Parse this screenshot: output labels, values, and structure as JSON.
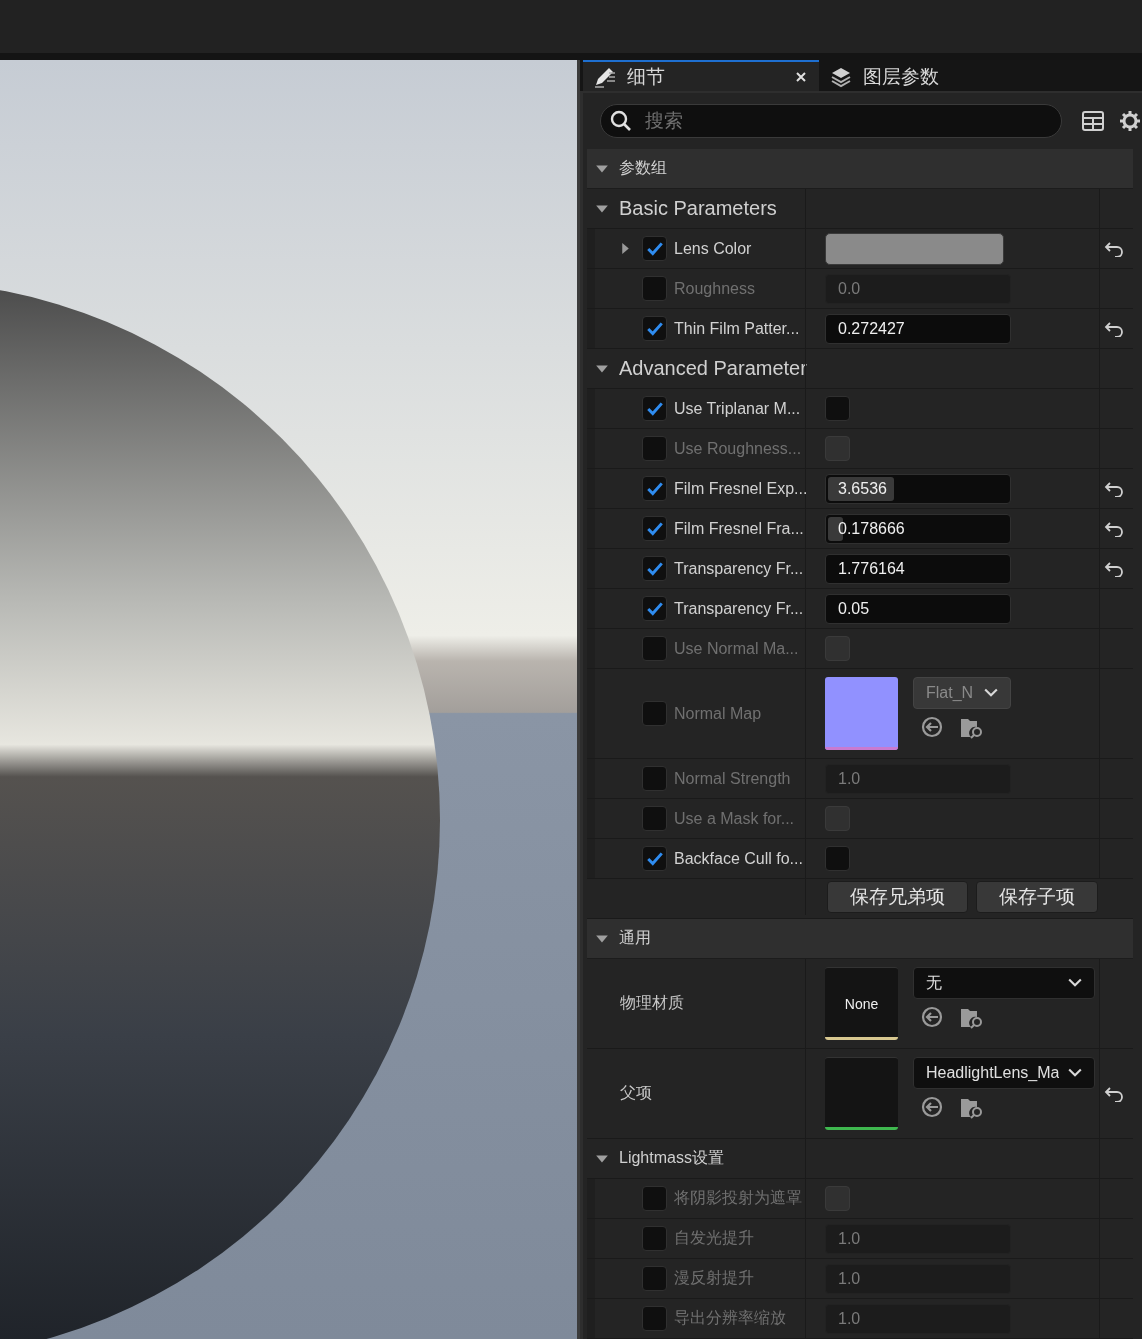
{
  "tabs": [
    {
      "label": "细节",
      "selected": true,
      "closable": true
    },
    {
      "label": "图层参数",
      "selected": false,
      "closable": false
    }
  ],
  "search": {
    "placeholder": "搜索"
  },
  "sections": [
    {
      "kind": "category",
      "title": "参数组",
      "expanded": true,
      "children": [
        {
          "kind": "group",
          "title": "Basic Parameters",
          "expanded": true,
          "rows": [
            {
              "kind": "color",
              "label": "Lens Color",
              "checked": true,
              "expanded": false,
              "color": "#8a8a8a",
              "reset": true
            },
            {
              "kind": "number",
              "label": "Roughness",
              "checked": false,
              "value": "0.0",
              "reset": false
            },
            {
              "kind": "number",
              "label": "Thin Film Patter...",
              "checked": true,
              "value": "0.272427",
              "reset": true
            }
          ]
        },
        {
          "kind": "group",
          "title": "Advanced Parameter",
          "expanded": true,
          "rows": [
            {
              "kind": "bool",
              "label": "Use Triplanar M...",
              "checked": true,
              "on": false,
              "reset": false
            },
            {
              "kind": "bool",
              "label": "Use Roughness...",
              "checked": false,
              "on": false,
              "reset": false
            },
            {
              "kind": "number",
              "label": "Film Fresnel Exp...",
              "checked": true,
              "value": "3.6536",
              "level": 0.36,
              "reset": true
            },
            {
              "kind": "number",
              "label": "Film Fresnel Fra...",
              "checked": true,
              "value": "0.178666",
              "level": 0.08,
              "reset": true
            },
            {
              "kind": "number",
              "label": "Transparency Fr...",
              "checked": true,
              "value": "1.776164",
              "reset": true
            },
            {
              "kind": "number",
              "label": "Transparency Fr...",
              "checked": true,
              "value": "0.05",
              "reset": false
            },
            {
              "kind": "bool",
              "label": "Use Normal Ma...",
              "checked": false,
              "on": false,
              "reset": false
            },
            {
              "kind": "texture",
              "label": "Normal Map",
              "checked": false,
              "value": "Flat_N",
              "color": "#c97ad0",
              "reset": false
            },
            {
              "kind": "number",
              "label": "Normal Strength",
              "checked": false,
              "value": "1.0",
              "reset": false
            },
            {
              "kind": "bool",
              "label": "Use a Mask for...",
              "checked": false,
              "on": false,
              "reset": false
            },
            {
              "kind": "bool",
              "label": "Backface Cull fo...",
              "checked": true,
              "on": false,
              "reset": false
            }
          ],
          "buttons": [
            "保存兄弟项",
            "保存子项"
          ]
        }
      ]
    },
    {
      "kind": "category",
      "title": "通用",
      "expanded": true,
      "rows": [
        {
          "kind": "asset",
          "label": "物理材质",
          "thumb": "None",
          "value": "无",
          "color": "#d8c890",
          "reset": false
        },
        {
          "kind": "asset",
          "label": "父项",
          "value": "HeadlightLens_Ma",
          "color": "#3fb84f",
          "reset": true
        }
      ]
    },
    {
      "kind": "subcategory",
      "title": "Lightmass设置",
      "expanded": true,
      "rows": [
        {
          "kind": "bool",
          "label": "将阴影投射为遮罩",
          "checked": false,
          "on": false,
          "reset": false
        },
        {
          "kind": "number",
          "label": "自发光提升",
          "checked": false,
          "value": "1.0",
          "reset": false
        },
        {
          "kind": "number",
          "label": "漫反射提升",
          "checked": false,
          "value": "1.0",
          "reset": false
        },
        {
          "kind": "number",
          "label": "导出分辨率缩放",
          "checked": false,
          "value": "1.0",
          "reset": false
        }
      ]
    }
  ]
}
